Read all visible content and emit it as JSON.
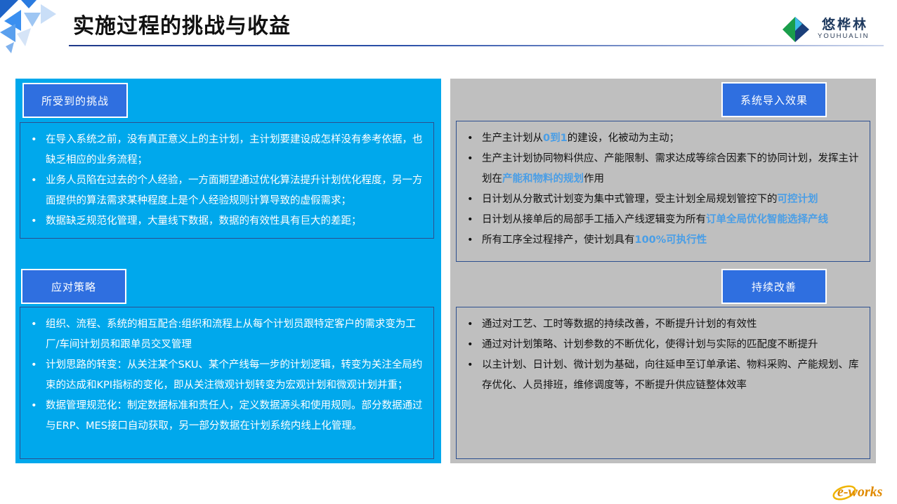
{
  "header": {
    "title": "实施过程的挑战与收益",
    "logo_cn": "悠桦林",
    "logo_en": "YOUHUALIN"
  },
  "colors": {
    "accent_blue": "#00a8ec",
    "button_blue": "#2f6fe0",
    "panel_gray": "#bfbfbf",
    "highlight": "#4a9ee6"
  },
  "left": {
    "challenges": {
      "label": "所受到的挑战",
      "items": [
        "在导入系统之前，没有真正意义上的主计划，主计划要建设成怎样没有参考依据，也缺乏相应的业务流程；",
        "业务人员陷在过去的个人经验，一方面期望通过优化算法提升计划优化程度，另一方面提供的算法需求某种程度上是个人经验规则计算导致的虚假需求；",
        "数据缺乏规范化管理，大量线下数据，数据的有效性具有巨大的差距；"
      ]
    },
    "strategy": {
      "label": "应对策略",
      "items": [
        "组织、流程、系统的相互配合:组织和流程上从每个计划员跟特定客户的需求变为工厂/车间计划员和跟单员交叉管理",
        "计划思路的转变：从关注某个SKU、某个产线每一步的计划逻辑，转变为关注全局约束的达成和KPI指标的变化，即从关注微观计划转变为宏观计划和微观计划并重；",
        "数据管理规范化：制定数据标准和责任人，定义数据源头和使用规则。部分数据通过与ERP、MES接口自动获取，另一部分数据在计划系统内线上化管理。"
      ]
    }
  },
  "right": {
    "effects": {
      "label": "系统导入效果",
      "items": [
        {
          "pre": "生产主计划从",
          "hl": "0到1",
          "post": "的建设，化被动为主动；"
        },
        {
          "pre": "生产主计划协同物料供应、产能限制、需求达成等综合因素下的协同计划，发挥主计划在",
          "hl": "产能和物料的规划",
          "post": "作用"
        },
        {
          "pre": "日计划从分散式计划变为集中式管理，受主计划全局规划管控下的",
          "hl": "可控计划",
          "post": ""
        },
        {
          "pre": "日计划从接单后的局部手工插入产线逻辑变为所有",
          "hl": "订单全局优化智能选择产线",
          "post": ""
        },
        {
          "pre": "所有工序全过程排产，使计划具有",
          "hl": "100%可执行性",
          "post": ""
        }
      ]
    },
    "improvement": {
      "label": "持续改善",
      "items": [
        "通过对工艺、工时等数据的持续改善，不断提升计划的有效性",
        "通过对计划策略、计划参数的不断优化，使得计划与实际的匹配度不断提升",
        "以主计划、日计划、微计划为基础，向往延申至订单承诺、物料采购、产能规划、库存优化、人员排班，维修调度等，不断提升供应链整体效率"
      ]
    }
  },
  "footer": {
    "brand": "e-works"
  }
}
